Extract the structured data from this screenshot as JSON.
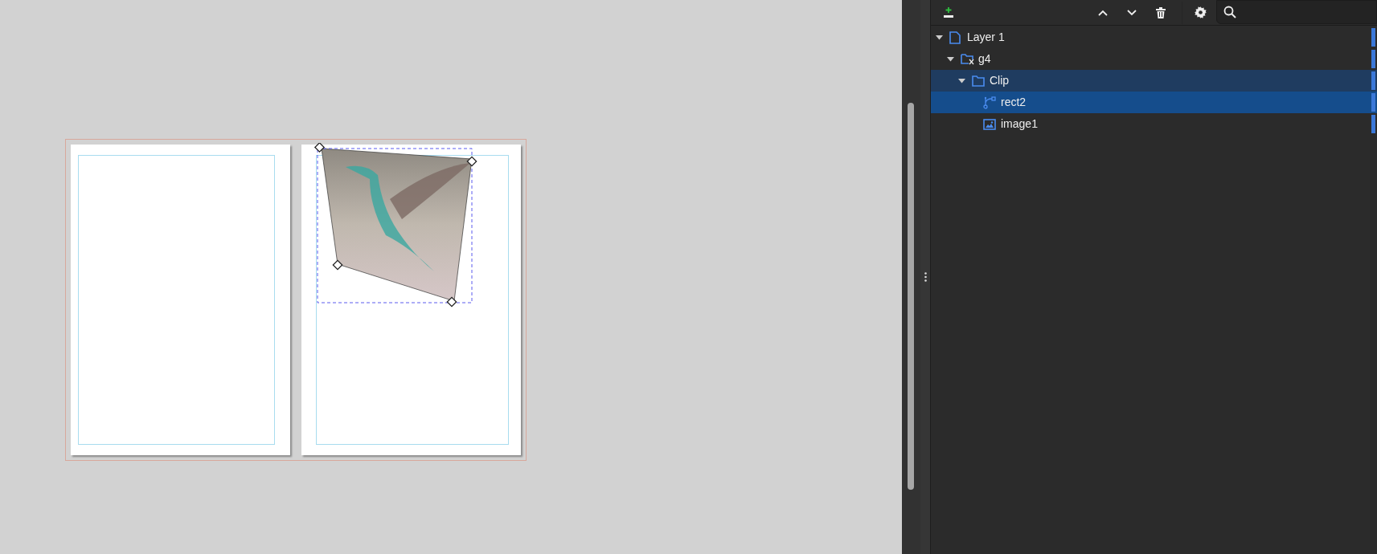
{
  "layers_panel": {
    "tree": [
      {
        "label": "Layer 1",
        "kind": "layer",
        "expanded": true,
        "selected": false,
        "highlighted": false,
        "children": [
          {
            "label": "g4",
            "kind": "clipped-group",
            "expanded": true,
            "selected": false,
            "highlighted": false,
            "children": [
              {
                "label": "Clip",
                "kind": "group",
                "expanded": true,
                "selected": false,
                "highlighted": true,
                "children": [
                  {
                    "label": "rect2",
                    "kind": "path",
                    "selected": true
                  },
                  {
                    "label": "image1",
                    "kind": "image",
                    "selected": false,
                    "highlighted": false
                  }
                ]
              }
            ]
          }
        ]
      }
    ]
  }
}
